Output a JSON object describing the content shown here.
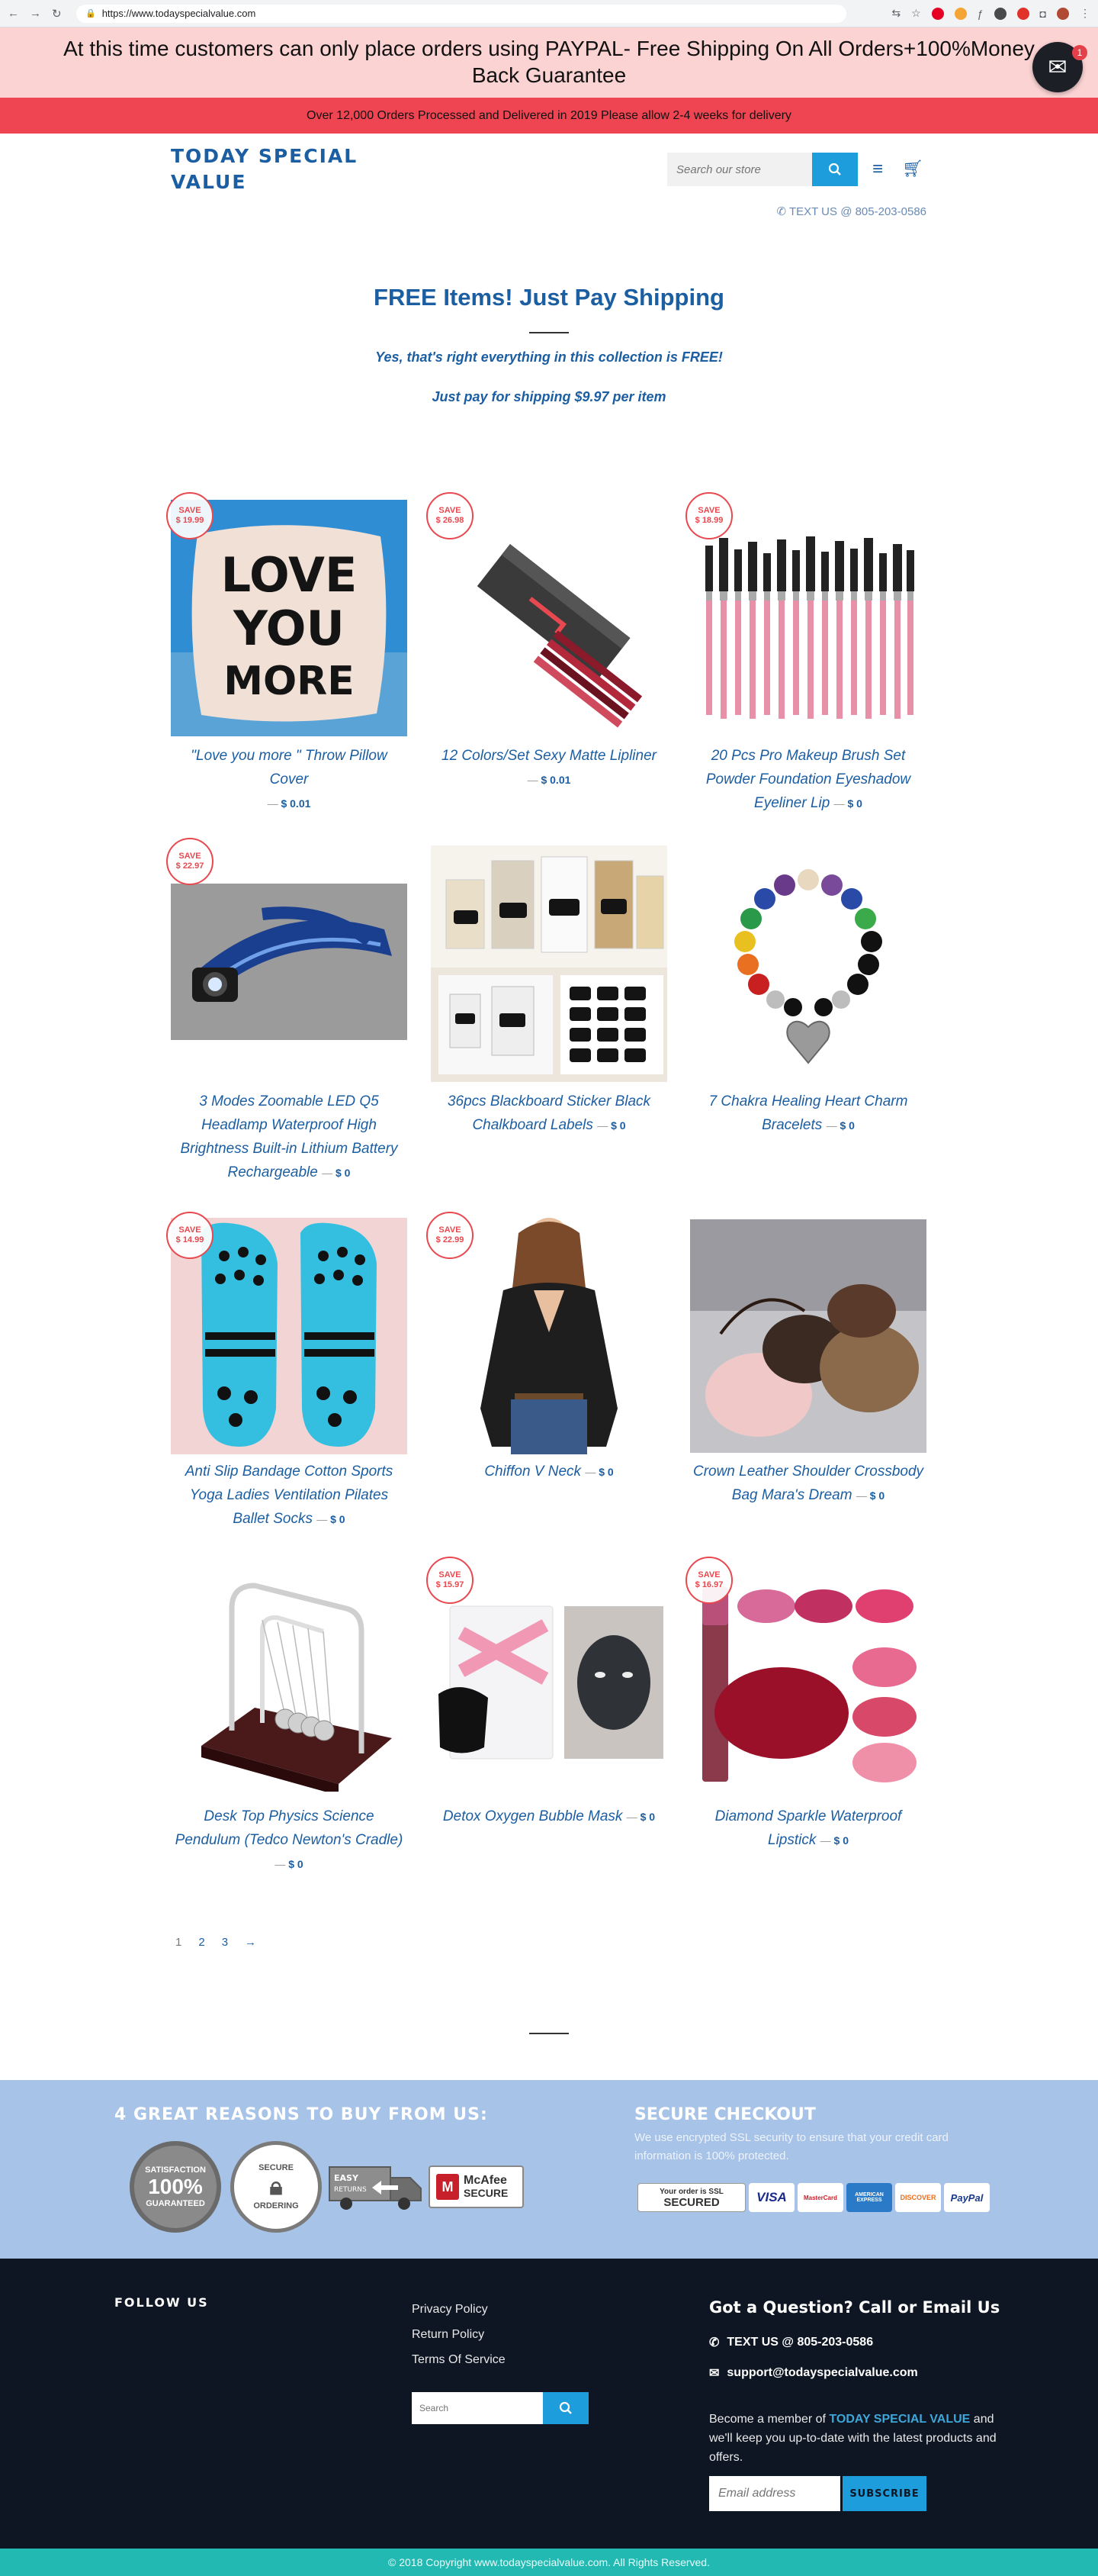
{
  "browser": {
    "url": "https://www.todayspecialvalue.com"
  },
  "announcement": {
    "text": "At this time customers can only place orders using PAYPAL- Free Shipping On All Orders+100%Money Back Guarantee",
    "badge_count": "1"
  },
  "notice_bar": {
    "text": "Over 12,000 Orders Processed and Delivered in 2019 Please allow 2-4 weeks for delivery"
  },
  "header": {
    "logo": "TODAY SPECIAL VALUE",
    "search_placeholder": "Search our store",
    "text_us": "TEXT US @ 805-203-0586"
  },
  "collection": {
    "title": "FREE Items! Just Pay Shipping",
    "line1": "Yes, that's right everything in this collection is FREE!",
    "line2": "Just pay for shipping $9.97 per item"
  },
  "products": [
    {
      "title": "\"Love you more \" Throw Pillow Cover",
      "price": "$ 0.01",
      "save": "$ 19.99"
    },
    {
      "title": "12 Colors/Set Sexy Matte Lipliner",
      "price": "$ 0.01",
      "save": "$ 26.98"
    },
    {
      "title": "20 Pcs Pro Makeup Brush Set Powder Foundation Eyeshadow Eyeliner Lip",
      "price": "$ 0",
      "save": "$ 18.99"
    },
    {
      "title": "3 Modes Zoomable LED Q5 Headlamp Waterproof High Brightness Built-in Lithium Battery Rechargeable",
      "price": "$ 0",
      "save": "$ 22.97"
    },
    {
      "title": "36pcs Blackboard Sticker Black Chalkboard Labels",
      "price": "$ 0",
      "save": ""
    },
    {
      "title": "7 Chakra Healing Heart Charm Bracelets",
      "price": "$ 0",
      "save": ""
    },
    {
      "title": "Anti Slip Bandage Cotton Sports Yoga Ladies Ventilation Pilates Ballet Socks",
      "price": "$ 0",
      "save": "$ 14.99"
    },
    {
      "title": "Chiffon V Neck",
      "price": "$ 0",
      "save": "$ 22.99"
    },
    {
      "title": "Crown Leather Shoulder Crossbody Bag Mara's Dream",
      "price": "$ 0",
      "save": ""
    },
    {
      "title": "Desk Top Physics Science Pendulum (Tedco Newton's Cradle)",
      "price": "$ 0",
      "save": ""
    },
    {
      "title": "Detox Oxygen Bubble Mask",
      "price": "$ 0",
      "save": "$ 15.97"
    },
    {
      "title": "Diamond Sparkle Waterproof Lipstick",
      "price": "$ 0",
      "save": "$ 16.97"
    }
  ],
  "save_label": "SAVE",
  "pagination": {
    "current": "1",
    "p2": "2",
    "p3": "3",
    "next": "→"
  },
  "reasons": {
    "title": "4 GREAT REASONS TO BUY FROM US:",
    "seal1_a": "SATISFACTION",
    "seal1_b": "100%",
    "seal1_c": "GUARANTEED",
    "seal2_a": "SECURE",
    "seal2_b": "ORDERING",
    "seal3_a": "EASY",
    "seal3_b": "RETURNS",
    "seal4_a": "McAfee",
    "seal4_b": "SECURE"
  },
  "secure": {
    "title": "SECURE CHECKOUT",
    "text": "We use encrypted SSL security to ensure that your credit card information is 100% protected.",
    "ssl_a": "Your order is SSL",
    "ssl_b": "SECURED",
    "cards": [
      "VISA",
      "MasterCard",
      "AMERICAN EXPRESS",
      "DISCOVER",
      "PayPal"
    ]
  },
  "footer": {
    "follow": "FOLLOW US",
    "links": [
      "Privacy Policy",
      "Return Policy",
      "Terms Of Service"
    ],
    "search_placeholder": "Search",
    "q_title": "Got a Question? Call or Email Us",
    "phone": "TEXT US @ 805-203-0586",
    "email_addr": "support@todayspecialvalue.com",
    "member_pre": "Become a member of ",
    "member_brand": "TODAY SPECIAL VALUE",
    "member_post": " and we'll keep you up-to-date with the latest products and offers.",
    "email_placeholder": "Email address",
    "subscribe": "SUBSCRIBE",
    "copyright": "© 2018 Copyright www.todayspecialvalue.com. All Rights Reserved."
  }
}
